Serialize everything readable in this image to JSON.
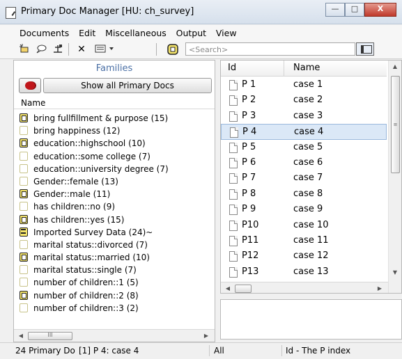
{
  "window": {
    "title": "Primary Doc Manager [HU: ch_survey]",
    "minimize": "—",
    "maximize": "□",
    "close": "X"
  },
  "menu": [
    "Documents",
    "Edit",
    "Miscellaneous",
    "Output",
    "View"
  ],
  "toolbar": {
    "delete": "✕",
    "search_placeholder": "<Search>"
  },
  "families": {
    "title": "Families",
    "show_all": "Show all Primary Docs",
    "column_name": "Name",
    "items": [
      {
        "label": "bring fullfillment & purpose (15)",
        "icon": "family-filled-icon"
      },
      {
        "label": "bring happiness (12)",
        "icon": "family-empty-icon"
      },
      {
        "label": "education::highschool (10)",
        "icon": "family-filled-icon"
      },
      {
        "label": "education::some college (7)",
        "icon": "family-empty-icon"
      },
      {
        "label": "education::university degree (7)",
        "icon": "family-empty-icon"
      },
      {
        "label": "Gender::female (13)",
        "icon": "family-empty-icon"
      },
      {
        "label": "Gender::male (11)",
        "icon": "family-filled-icon"
      },
      {
        "label": "has children::no (9)",
        "icon": "family-empty-icon"
      },
      {
        "label": "has children::yes (15)",
        "icon": "family-filled-icon"
      },
      {
        "label": "Imported Survey Data (24)~",
        "icon": "imported-data-icon"
      },
      {
        "label": "marital status::divorced (7)",
        "icon": "family-empty-icon"
      },
      {
        "label": "marital status::married (10)",
        "icon": "family-filled-icon"
      },
      {
        "label": "marital status::single (7)",
        "icon": "family-empty-icon"
      },
      {
        "label": "number of children::1 (5)",
        "icon": "family-empty-icon"
      },
      {
        "label": "number of children::2 (8)",
        "icon": "family-filled-icon"
      },
      {
        "label": "number of children::3 (2)",
        "icon": "family-empty-icon"
      }
    ],
    "scroll_grip": "III"
  },
  "docs": {
    "columns": {
      "id": "Id",
      "name": "Name"
    },
    "rows": [
      {
        "id": "P 1",
        "name": "case 1"
      },
      {
        "id": "P 2",
        "name": "case 2"
      },
      {
        "id": "P 3",
        "name": "case 3"
      },
      {
        "id": "P 4",
        "name": "case 4",
        "selected": true
      },
      {
        "id": "P 5",
        "name": "case 5"
      },
      {
        "id": "P 6",
        "name": "case 6"
      },
      {
        "id": "P 7",
        "name": "case 7"
      },
      {
        "id": "P 8",
        "name": "case 8"
      },
      {
        "id": "P 9",
        "name": "case 9"
      },
      {
        "id": "P10",
        "name": "case 10"
      },
      {
        "id": "P11",
        "name": "case 11"
      },
      {
        "id": "P12",
        "name": "case 12"
      },
      {
        "id": "P13",
        "name": "case 13"
      }
    ],
    "vscroll_grip": "≡"
  },
  "status": {
    "count": "24 Primary Do",
    "selection": "[1] P 4: case 4",
    "filter": "All",
    "sort": "Id - The P index"
  },
  "colors": {
    "families_title": "#4a6fa5",
    "selected_row": "#dbe8f7",
    "family_icon_fill": "#f5e56b",
    "red_button": "#c0161b"
  }
}
